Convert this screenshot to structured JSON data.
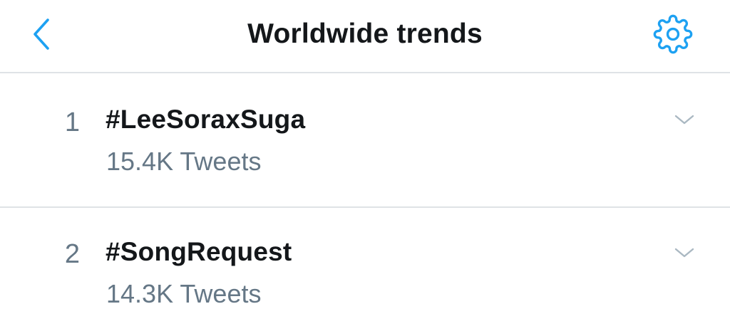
{
  "header": {
    "title": "Worldwide trends",
    "back_icon": "chevron-left-icon",
    "settings_icon": "gear-icon"
  },
  "colors": {
    "accent": "#1da1f2",
    "text_primary": "#14171a",
    "text_secondary": "#657786",
    "divider": "#dfe3e6",
    "chevron": "#aab8c2"
  },
  "trends": [
    {
      "rank": "1",
      "hashtag": "#LeeSoraxSuga",
      "tweet_count": "15.4K Tweets",
      "menu_icon": "chevron-down-icon"
    },
    {
      "rank": "2",
      "hashtag": "#SongRequest",
      "tweet_count": "14.3K Tweets",
      "menu_icon": "chevron-down-icon"
    }
  ]
}
